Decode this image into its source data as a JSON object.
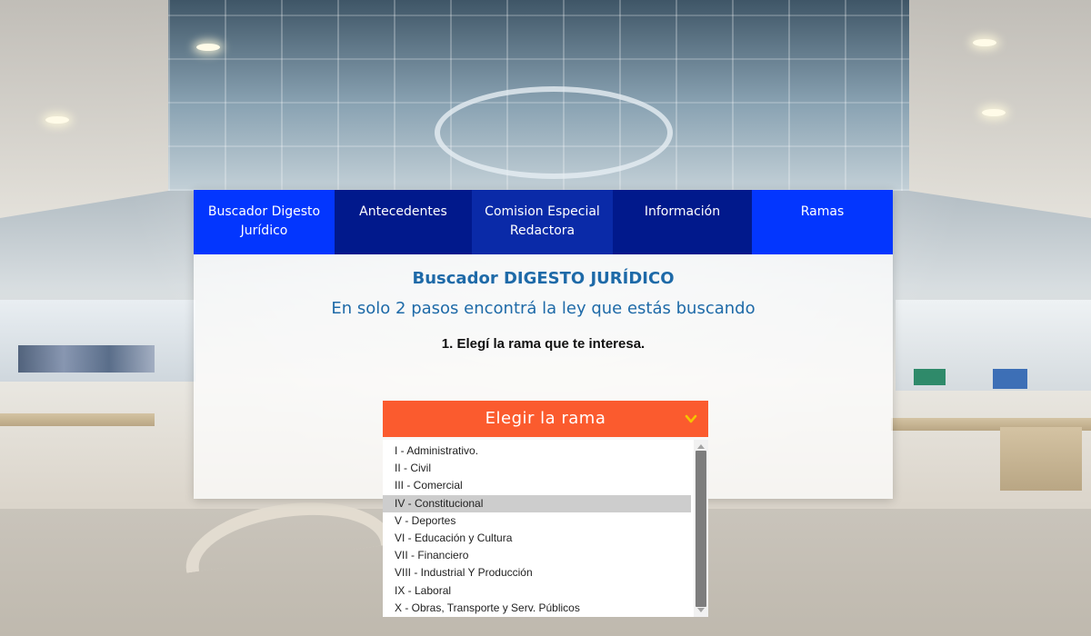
{
  "nav": {
    "items": [
      {
        "label_line1": "Buscador Digesto",
        "label_line2": "Jurídico",
        "style": "blue"
      },
      {
        "label_line1": "Antecedentes",
        "label_line2": "",
        "style": "dark"
      },
      {
        "label_line1": "Comision Especial",
        "label_line2": "Redactora",
        "style": "dark"
      },
      {
        "label_line1": "Información",
        "label_line2": "",
        "style": "dark"
      },
      {
        "label_line1": "Ramas",
        "label_line2": "",
        "style": "blue"
      }
    ]
  },
  "main": {
    "title": "Buscador DIGESTO JURÍDICO",
    "subtitle": "En solo 2 pasos encontrá la ley que estás buscando",
    "step": "1. Elegí la rama que te interesa."
  },
  "dropdown": {
    "label": "Elegir la rama",
    "icon": "chevron-down-icon",
    "selected_index": 3,
    "options": [
      "I - Administrativo.",
      "II - Civil",
      "III - Comercial",
      "IV - Constitucional",
      "V - Deportes",
      "VI - Educación y Cultura",
      "VII - Financiero",
      "VIII - Industrial Y Producción",
      "IX - Laboral",
      "X - Obras, Transporte y Serv. Públicos"
    ]
  },
  "colors": {
    "nav_blue": "#0336fe",
    "nav_dark": "#01198c",
    "title_blue": "#1e6aa8",
    "dropdown_orange": "#fb5b2e",
    "chevron_yellow": "#f5c400",
    "selected_gray": "#cdcdcd"
  }
}
